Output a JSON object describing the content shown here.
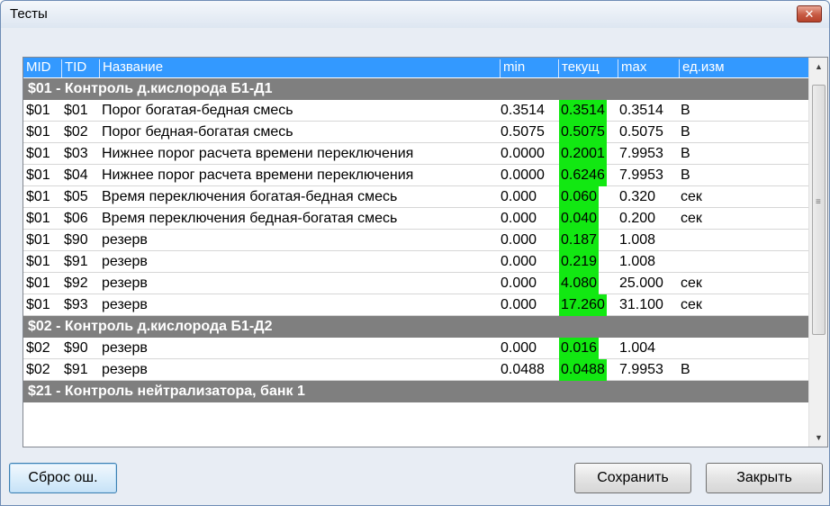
{
  "window": {
    "title": "Тесты",
    "close_glyph": "✕"
  },
  "grid": {
    "columns": [
      "MID",
      "TID",
      "Название",
      "min",
      "текущ",
      "max",
      "ед.изм"
    ],
    "rows": [
      {
        "group": "$01 - Контроль д.кислорода Б1-Д1"
      },
      {
        "mid": "$01",
        "tid": "$01",
        "name": "Порог богатая-бедная смесь",
        "min": "0.3514",
        "cur": "0.3514",
        "max": "0.3514",
        "unit": "В"
      },
      {
        "mid": "$01",
        "tid": "$02",
        "name": "Порог бедная-богатая смесь",
        "min": "0.5075",
        "cur": "0.5075",
        "max": "0.5075",
        "unit": "В"
      },
      {
        "mid": "$01",
        "tid": "$03",
        "name": "Нижнее порог расчета времени переключения",
        "min": "0.0000",
        "cur": "0.2001",
        "max": "7.9953",
        "unit": "В"
      },
      {
        "mid": "$01",
        "tid": "$04",
        "name": "Нижнее порог расчета времени переключения",
        "min": "0.0000",
        "cur": "0.6246",
        "max": "7.9953",
        "unit": "В"
      },
      {
        "mid": "$01",
        "tid": "$05",
        "name": "Время переключения богатая-бедная смесь",
        "min": "0.000",
        "cur": "0.060",
        "max": "0.320",
        "unit": "сек"
      },
      {
        "mid": "$01",
        "tid": "$06",
        "name": "Время переключения бедная-богатая смесь",
        "min": "0.000",
        "cur": "0.040",
        "max": "0.200",
        "unit": "сек"
      },
      {
        "mid": "$01",
        "tid": "$90",
        "name": "резерв",
        "min": "0.000",
        "cur": "0.187",
        "max": "1.008",
        "unit": ""
      },
      {
        "mid": "$01",
        "tid": "$91",
        "name": "резерв",
        "min": "0.000",
        "cur": "0.219",
        "max": "1.008",
        "unit": ""
      },
      {
        "mid": "$01",
        "tid": "$92",
        "name": "резерв",
        "min": "0.000",
        "cur": "4.080",
        "max": "25.000",
        "unit": "сек"
      },
      {
        "mid": "$01",
        "tid": "$93",
        "name": "резерв",
        "min": "0.000",
        "cur": "17.260",
        "max": "31.100",
        "unit": "сек"
      },
      {
        "group": "$02 - Контроль д.кислорода Б1-Д2"
      },
      {
        "mid": "$02",
        "tid": "$90",
        "name": "резерв",
        "min": "0.000",
        "cur": "0.016",
        "max": "1.004",
        "unit": ""
      },
      {
        "mid": "$02",
        "tid": "$91",
        "name": "резерв",
        "min": "0.0488",
        "cur": "0.0488",
        "max": "7.9953",
        "unit": "В"
      },
      {
        "group": "$21 - Контроль нейтрализатора, банк 1"
      }
    ]
  },
  "scrollbar": {
    "up_glyph": "▲",
    "down_glyph": "▼",
    "grip_glyph": "≡"
  },
  "buttons": {
    "reset": "Сброс ош.",
    "save": "Сохранить",
    "close": "Закрыть"
  },
  "colors": {
    "header": "#3399ff",
    "group_row": "#7f7f7f",
    "current_value": "#12e812"
  }
}
